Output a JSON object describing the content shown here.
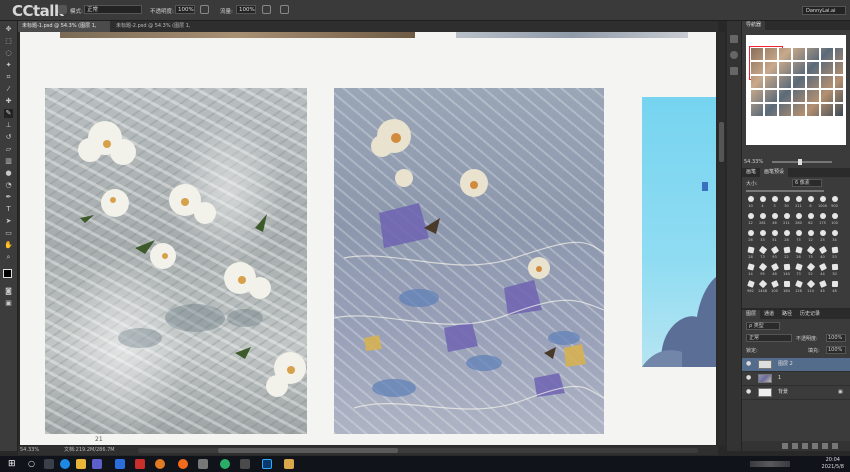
{
  "brand": {
    "logo_text": "CCtalk"
  },
  "options_bar": {
    "mode_label": "模式:",
    "mode_value": "正常",
    "opacity_label": "不透明度:",
    "opacity_value": "100%",
    "flow_label": "流量:",
    "flow_value": "100%",
    "workspace": "DannyLai.ai"
  },
  "document_tabs": [
    {
      "label": "未标题-1.psd @ 54.3% (图层 1, RGB/8#)"
    },
    {
      "label": "未标题-2.psd @ 54.3% (图层 1, RGB/8#)"
    }
  ],
  "status_bar": {
    "zoom": "54.33%",
    "doc": "文档:219.2M/286.7M",
    "page_number": "21"
  },
  "navigator": {
    "tab": "导航器",
    "zoom": "54.33%"
  },
  "brushes_panel": {
    "tabs": [
      "画笔",
      "画笔预设"
    ],
    "size_label": "大小:",
    "size_value": "6 像素",
    "brush_sizes": [
      "10",
      "4",
      "3",
      "30",
      "211",
      "8",
      "1000",
      "900",
      "12",
      "281",
      "46",
      "211",
      "280",
      "62",
      "175",
      "100",
      "26",
      "33",
      "51",
      "28",
      "75",
      "12",
      "25",
      "34",
      "28",
      "73",
      "93",
      "22",
      "28",
      "75",
      "40",
      "53",
      "14",
      "95",
      "48",
      "140",
      "73",
      "52",
      "44",
      "30",
      "962",
      "1448",
      "100",
      "184",
      "126",
      "114",
      "45",
      "48"
    ]
  },
  "layers_panel": {
    "tabs": [
      "图层",
      "通道",
      "路径",
      "历史记录"
    ],
    "filter_label": "ρ 类型",
    "blend_mode": "正常",
    "opacity_label": "不透明度:",
    "opacity_value": "100%",
    "lock_label": "锁定:",
    "fill_label": "填充:",
    "fill_value": "100%",
    "layers": [
      {
        "name": "图层 2",
        "selected": true
      },
      {
        "name": "1",
        "selected": false
      },
      {
        "name": "背景",
        "selected": false
      }
    ]
  },
  "taskbar": {
    "time": "20:04",
    "date": "2021/5/8"
  }
}
